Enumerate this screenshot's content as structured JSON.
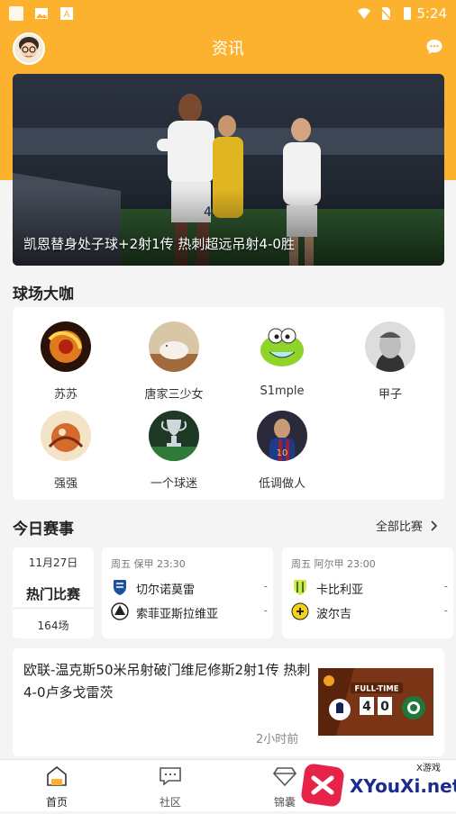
{
  "status_bar": {
    "time": "5:24"
  },
  "header": {
    "title": "资讯"
  },
  "banner": {
    "caption": "凯恩替身处子球+2射1传 热刺超远吊射4-0胜"
  },
  "celebrities": {
    "title": "球场大咖",
    "items": [
      {
        "name": "苏苏"
      },
      {
        "name": "唐家三少女"
      },
      {
        "name": "S1mple"
      },
      {
        "name": "甲子"
      },
      {
        "name": "强强"
      },
      {
        "name": "一个球迷"
      },
      {
        "name": "低调做人"
      }
    ]
  },
  "matches": {
    "title": "今日赛事",
    "all_link": "全部比赛",
    "date": "11月27日",
    "hot_label": "热门比赛",
    "count": "164场",
    "games": [
      {
        "meta": "周五   保甲   23:30",
        "home": {
          "name": "切尔诺莫雷",
          "score": "-"
        },
        "away": {
          "name": "索菲亚斯拉维亚",
          "score": "-"
        }
      },
      {
        "meta": "周五   阿尔甲   23:00",
        "home": {
          "name": "卡比利亚",
          "score": "-"
        },
        "away": {
          "name": "波尔吉",
          "score": "-"
        }
      }
    ]
  },
  "news": {
    "headline": "欧联-温克斯50米吊射破门维尼修斯2射1传 热刺4-0卢多戈雷茨",
    "time": "2小时前",
    "thumb_text": "FULL-TIME",
    "thumb_score_home": "4",
    "thumb_score_away": "0"
  },
  "tabbar": {
    "tabs": [
      {
        "label": "首页"
      },
      {
        "label": "社区"
      },
      {
        "label": "锦囊"
      }
    ]
  },
  "watermark": {
    "top": "X游戏",
    "main": "XYouXi.net"
  }
}
